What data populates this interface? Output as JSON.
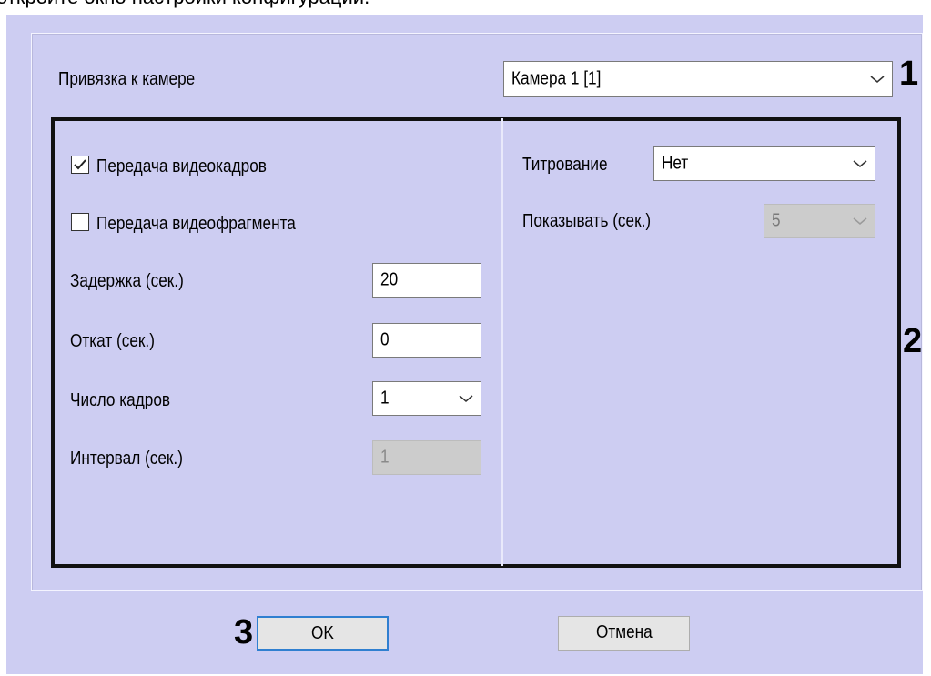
{
  "caption": "откройте окно настройки конфигурации.",
  "camera_binding": {
    "label": "Привязка к камере",
    "value": "Камера 1 [1]"
  },
  "left_panel": {
    "video_frames_checkbox": {
      "label": "Передача видеокадров",
      "checked": true
    },
    "video_fragment_checkbox": {
      "label": "Передача видеофрагмента",
      "checked": false
    },
    "delay": {
      "label": "Задержка (сек.)",
      "value": "20"
    },
    "rollback": {
      "label": "Откат (сек.)",
      "value": "0"
    },
    "frame_count": {
      "label": "Число кадров",
      "value": "1"
    },
    "interval": {
      "label": "Интервал (сек.)",
      "value": "1"
    }
  },
  "right_panel": {
    "titling": {
      "label": "Титрование",
      "value": "Нет"
    },
    "show_seconds": {
      "label": "Показывать (сек.)",
      "value": "5"
    }
  },
  "markers": {
    "one": "1",
    "two": "2",
    "three": "3"
  },
  "buttons": {
    "ok": "OK",
    "cancel": "Отмена"
  },
  "icons": {
    "check": "checkmark-icon",
    "dropdown": "chevron-down-icon"
  },
  "colors": {
    "dialog_bg": "#cdcdf2",
    "default_button_border": "#2f7fd0",
    "annotation_frame": "#111111"
  }
}
